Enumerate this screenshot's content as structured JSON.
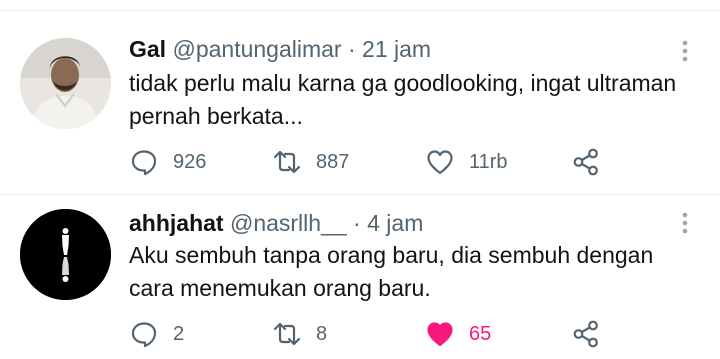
{
  "tweets": [
    {
      "name": "Gal",
      "handle": "@pantungalimar",
      "separator": "·",
      "time": "21 jam",
      "text": "tidak perlu malu karna ga goodlooking, ingat ultraman pernah berkata...",
      "replies": "926",
      "retweets": "887",
      "likes": "11rb",
      "liked": false,
      "avatar": "photo of man in white shirt"
    },
    {
      "name": "ahhjahat",
      "handle": "@nasrllh__",
      "separator": "·",
      "time": "4 jam",
      "text": "Aku sembuh tanpa orang baru, dia sembuh dengan cara menemukan orang baru.",
      "replies": "2",
      "retweets": "8",
      "likes": "65",
      "liked": true,
      "avatar": "black circle with white standing figure and reflection"
    }
  ],
  "icons": {
    "reply": "comment-bubble-icon",
    "retweet": "retweet-icon",
    "like": "heart-icon",
    "share": "share-icon",
    "more": "more-vertical-icon"
  },
  "colors": {
    "text": "#0f1419",
    "secondary": "#536471",
    "like_active": "#f91880",
    "divider": "#e6ecf0"
  }
}
